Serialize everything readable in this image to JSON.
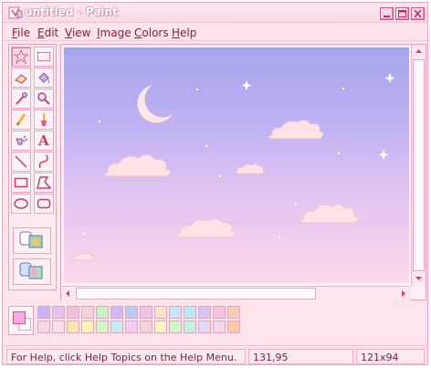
{
  "window": {
    "title": "untitled - Paint",
    "controls": [
      "minimize-icon",
      "maximize-icon",
      "close-icon"
    ]
  },
  "menu": {
    "items": [
      {
        "label": "File",
        "accel": "F",
        "rest": "ile"
      },
      {
        "label": "Edit",
        "accel": "E",
        "rest": "dit"
      },
      {
        "label": "View",
        "accel": "V",
        "rest": "iew"
      },
      {
        "label": "Image",
        "accel": "I",
        "rest": "mage"
      },
      {
        "label": "Colors",
        "accel": "C",
        "rest": "olors"
      },
      {
        "label": "Help",
        "accel": "H",
        "rest": "elp"
      }
    ]
  },
  "tools": [
    {
      "name": "free-form-select",
      "icon": "star-select-icon"
    },
    {
      "name": "rectangle-select",
      "icon": "dashed-rectangle-icon"
    },
    {
      "name": "eraser",
      "icon": "eraser-icon"
    },
    {
      "name": "fill",
      "icon": "paint-bucket-icon"
    },
    {
      "name": "pick-color",
      "icon": "eyedropper-icon"
    },
    {
      "name": "magnifier",
      "icon": "magnifier-icon"
    },
    {
      "name": "pencil",
      "icon": "pencil-icon"
    },
    {
      "name": "brush",
      "icon": "brush-icon"
    },
    {
      "name": "airbrush",
      "icon": "airbrush-icon"
    },
    {
      "name": "text",
      "icon": "text-icon",
      "glyph": "A"
    },
    {
      "name": "line",
      "icon": "line-icon"
    },
    {
      "name": "curve",
      "icon": "curve-icon"
    },
    {
      "name": "rectangle",
      "icon": "rectangle-icon"
    },
    {
      "name": "polygon",
      "icon": "polygon-icon"
    },
    {
      "name": "ellipse",
      "icon": "ellipse-icon"
    },
    {
      "name": "rounded-rectangle",
      "icon": "rounded-rectangle-icon"
    }
  ],
  "colors": {
    "accent": "#e44d7c",
    "window_bg": "#ffe4ec",
    "sky_top": "#a9a7ee",
    "sky_bottom": "#fbd9ea",
    "foreground": "#f8a9e6",
    "background": "#ffffff"
  },
  "palette": {
    "row1": [
      "#c9b5f2",
      "#e4c3f0",
      "#f2c0d9",
      "#f6d2de",
      "#c9efc4",
      "#cdb9f5",
      "#b9ccf4",
      "#f0c4e4",
      "#fde3cd",
      "#c9e4f7",
      "#bce8f2",
      "#d6c7f0",
      "#f3c4dc",
      "#f9cdb8"
    ],
    "row2": [
      "#f7d7e7",
      "#fbe1ee",
      "#fde3b8",
      "#fff5b9",
      "#d8f3c4",
      "#c7ecf2",
      "#f2cdf2",
      "#f7d1dd",
      "#fff0c6",
      "#d3f6c9",
      "#c4f0e2",
      "#e4d6f6",
      "#f5d8ec",
      "#fbc8b0"
    ]
  },
  "status": {
    "help_text": "For Help, click Help Topics on the Help Menu.",
    "coordinates": "131,95",
    "size": "121x94"
  },
  "scene": {
    "moon": "crescent-moon-icon",
    "clouds": [
      "cloud-icon",
      "cloud-icon",
      "cloud-icon",
      "cloud-icon",
      "cloud-icon",
      "cloud-icon"
    ]
  }
}
